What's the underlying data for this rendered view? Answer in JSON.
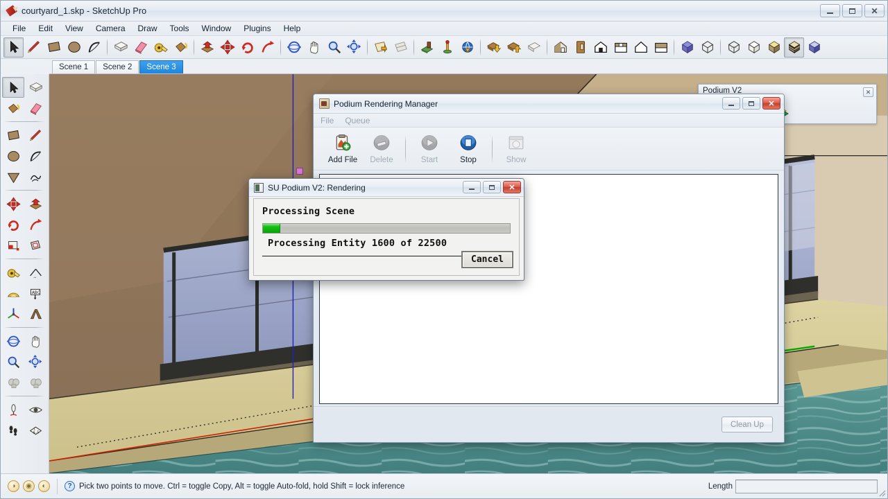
{
  "window": {
    "title": "courtyard_1.skp - SketchUp Pro",
    "app_icon": "sketchup-pencil-icon",
    "controls": {
      "minimize": "–",
      "restore": "❐",
      "close": "✕"
    }
  },
  "menubar": {
    "items": [
      "File",
      "Edit",
      "View",
      "Camera",
      "Draw",
      "Tools",
      "Window",
      "Plugins",
      "Help"
    ]
  },
  "toolbar_top": {
    "groups": [
      {
        "buttons": [
          {
            "name": "select-tool",
            "icon": "arrow-cursor-icon",
            "pressed": true
          },
          {
            "name": "line-tool",
            "icon": "pencil-icon",
            "pressed": false
          },
          {
            "name": "rectangle-tool",
            "icon": "rectangle-icon",
            "pressed": false
          },
          {
            "name": "circle-tool",
            "icon": "circle-icon",
            "pressed": false
          },
          {
            "name": "arc-tool",
            "icon": "arc-icon",
            "pressed": false
          }
        ]
      },
      {
        "buttons": [
          {
            "name": "make-component-tool",
            "icon": "component-icon",
            "pressed": false
          },
          {
            "name": "eraser-tool",
            "icon": "eraser-icon",
            "pressed": false
          },
          {
            "name": "tape-measure-tool",
            "icon": "tape-measure-icon",
            "pressed": false
          },
          {
            "name": "paint-bucket-tool",
            "icon": "paint-bucket-icon",
            "pressed": false
          }
        ]
      },
      {
        "buttons": [
          {
            "name": "push-pull-tool",
            "icon": "push-pull-icon",
            "pressed": false
          },
          {
            "name": "move-tool",
            "icon": "move-arrows-icon",
            "pressed": false
          },
          {
            "name": "rotate-tool",
            "icon": "rotate-icon",
            "pressed": false
          },
          {
            "name": "follow-me-tool",
            "icon": "follow-me-icon",
            "pressed": false
          }
        ]
      },
      {
        "buttons": [
          {
            "name": "orbit-tool",
            "icon": "orbit-icon",
            "pressed": false
          },
          {
            "name": "pan-tool",
            "icon": "hand-icon",
            "pressed": false
          },
          {
            "name": "zoom-tool",
            "icon": "magnifier-icon",
            "pressed": false
          },
          {
            "name": "zoom-extents-tool",
            "icon": "zoom-extents-icon",
            "pressed": false
          }
        ]
      },
      {
        "buttons": [
          {
            "name": "section-plane-tool",
            "icon": "section-plane-icon",
            "pressed": false
          },
          {
            "name": "section-display-tool",
            "icon": "section-display-icon",
            "pressed": false
          }
        ]
      },
      {
        "buttons": [
          {
            "name": "add-location-tool",
            "icon": "geo-location-icon",
            "pressed": false
          },
          {
            "name": "toggle-terrain-tool",
            "icon": "terrain-pin-icon",
            "pressed": false
          },
          {
            "name": "photo-textures-tool",
            "icon": "globe-arrow-icon",
            "pressed": false
          }
        ]
      },
      {
        "buttons": [
          {
            "name": "get-models-tool",
            "icon": "warehouse-download-icon",
            "pressed": false
          },
          {
            "name": "share-model-tool",
            "icon": "warehouse-upload-icon",
            "pressed": false
          },
          {
            "name": "share-component-tool",
            "icon": "share-component-icon",
            "pressed": false
          }
        ]
      },
      {
        "buttons": [
          {
            "name": "style-shaded-texture",
            "icon": "house-textured-icon",
            "pressed": false
          },
          {
            "name": "style-door",
            "icon": "door-icon",
            "pressed": false
          },
          {
            "name": "style-house-solid",
            "icon": "house-solid-icon",
            "pressed": false
          },
          {
            "name": "style-house-flat",
            "icon": "house-flat-icon",
            "pressed": false
          },
          {
            "name": "style-house-outline",
            "icon": "house-outline-icon",
            "pressed": false
          },
          {
            "name": "style-house-shaded",
            "icon": "house-shaded-icon",
            "pressed": false
          }
        ]
      },
      {
        "buttons": [
          {
            "name": "face-style-xray",
            "icon": "cube-xray-icon",
            "pressed": false
          },
          {
            "name": "face-style-wireframe",
            "icon": "cube-wireframe-icon",
            "pressed": false
          }
        ]
      },
      {
        "buttons": [
          {
            "name": "face-style-hidden-line",
            "icon": "cube-hidden-line-icon",
            "pressed": false
          },
          {
            "name": "face-style-monochrome",
            "icon": "cube-monochrome-icon",
            "pressed": false
          },
          {
            "name": "face-style-shaded",
            "icon": "cube-shaded-icon",
            "pressed": false
          },
          {
            "name": "face-style-textured",
            "icon": "cube-textured-icon",
            "pressed": true
          },
          {
            "name": "face-style-blue",
            "icon": "cube-blue-icon",
            "pressed": false
          }
        ]
      }
    ]
  },
  "tabs": {
    "scenes": [
      {
        "label": "Scene 1",
        "active": false
      },
      {
        "label": "Scene 2",
        "active": false
      },
      {
        "label": "Scene 3",
        "active": true
      }
    ]
  },
  "toolbar_left": {
    "rows": [
      {
        "sep_after": false,
        "buttons": [
          {
            "name": "select-tool",
            "icon": "arrow-cursor-icon",
            "pressed": true
          },
          {
            "name": "make-component-tool",
            "icon": "component-icon",
            "pressed": false
          }
        ]
      },
      {
        "sep_after": true,
        "buttons": [
          {
            "name": "paint-bucket-tool",
            "icon": "paint-bucket-icon",
            "pressed": false
          },
          {
            "name": "eraser-tool",
            "icon": "eraser-icon",
            "pressed": false
          }
        ]
      },
      {
        "sep_after": false,
        "buttons": [
          {
            "name": "rectangle-tool",
            "icon": "rectangle-icon",
            "pressed": false
          },
          {
            "name": "line-tool",
            "icon": "pencil-icon",
            "pressed": false
          }
        ]
      },
      {
        "sep_after": false,
        "buttons": [
          {
            "name": "circle-tool",
            "icon": "circle-icon",
            "pressed": false
          },
          {
            "name": "arc-tool",
            "icon": "arc-icon",
            "pressed": false
          }
        ]
      },
      {
        "sep_after": true,
        "buttons": [
          {
            "name": "polygon-tool",
            "icon": "polygon-icon",
            "pressed": false
          },
          {
            "name": "freehand-tool",
            "icon": "freehand-icon",
            "pressed": false
          }
        ]
      },
      {
        "sep_after": false,
        "buttons": [
          {
            "name": "move-tool",
            "icon": "move-arrows-icon",
            "pressed": false
          },
          {
            "name": "push-pull-tool",
            "icon": "push-pull-icon",
            "pressed": false
          }
        ]
      },
      {
        "sep_after": false,
        "buttons": [
          {
            "name": "rotate-tool",
            "icon": "rotate-icon",
            "pressed": false
          },
          {
            "name": "follow-me-tool",
            "icon": "follow-me-icon",
            "pressed": false
          }
        ]
      },
      {
        "sep_after": true,
        "buttons": [
          {
            "name": "scale-tool",
            "icon": "scale-icon",
            "pressed": false
          },
          {
            "name": "offset-tool",
            "icon": "offset-icon",
            "pressed": false
          }
        ]
      },
      {
        "sep_after": false,
        "buttons": [
          {
            "name": "tape-measure-tool",
            "icon": "tape-measure-icon",
            "pressed": false
          },
          {
            "name": "dimension-tool",
            "icon": "dimension-icon",
            "pressed": false
          }
        ]
      },
      {
        "sep_after": false,
        "buttons": [
          {
            "name": "protractor-tool",
            "icon": "protractor-icon",
            "pressed": false
          },
          {
            "name": "text-tool",
            "icon": "text-abc-icon",
            "pressed": false
          }
        ]
      },
      {
        "sep_after": true,
        "buttons": [
          {
            "name": "axes-tool",
            "icon": "axes-icon",
            "pressed": false
          },
          {
            "name": "three-d-text-tool",
            "icon": "three-d-text-icon",
            "pressed": false
          }
        ]
      },
      {
        "sep_after": false,
        "buttons": [
          {
            "name": "orbit-tool",
            "icon": "orbit-icon",
            "pressed": false
          },
          {
            "name": "pan-tool",
            "icon": "hand-icon",
            "pressed": false
          }
        ]
      },
      {
        "sep_after": false,
        "buttons": [
          {
            "name": "zoom-tool",
            "icon": "magnifier-icon",
            "pressed": false
          },
          {
            "name": "zoom-extents-tool",
            "icon": "zoom-extents-icon",
            "pressed": false
          }
        ]
      },
      {
        "sep_after": true,
        "buttons": [
          {
            "name": "zoom-window-tool",
            "icon": "camera-disabled-icon",
            "pressed": false
          },
          {
            "name": "previous-view-tool",
            "icon": "camera-disabled-icon",
            "pressed": false
          }
        ]
      },
      {
        "sep_after": false,
        "buttons": [
          {
            "name": "position-camera-tool",
            "icon": "position-camera-icon",
            "pressed": false
          },
          {
            "name": "look-around-tool",
            "icon": "eye-icon",
            "pressed": false
          }
        ]
      },
      {
        "sep_after": false,
        "buttons": [
          {
            "name": "walk-tool",
            "icon": "footprints-icon",
            "pressed": false
          },
          {
            "name": "section-marker-tool",
            "icon": "section-marker-icon",
            "pressed": false
          }
        ]
      }
    ]
  },
  "viewport": {
    "name": "sketchup-3d-viewport",
    "description": "Courtyard model: stucco wall, glass curtain wall, deck and pool",
    "colors": {
      "sky": "#eceae4",
      "wall": "#927a5e",
      "wall_shadow": "#6f5b45",
      "wall_light": "#c9b28c",
      "glass": "#9aa3c4",
      "glass_light": "#c2c8df",
      "mullion": "#2b2b28",
      "deck": "#d9cf9a",
      "deck_dark": "#b9ab76",
      "water": "#4f8f8c",
      "water_light": "#8fc0bc",
      "axis_red": "#cc2200",
      "axis_blue": "#2222bb",
      "axis_green": "#00aa00"
    }
  },
  "podium_toolbar": {
    "title": "Podium V2",
    "close_label": "✕",
    "buttons": [
      {
        "name": "podium-render-button",
        "icon": "render-lamp-icon"
      },
      {
        "name": "podium-options-button",
        "icon": "gear-icon"
      },
      {
        "name": "podium-materials-button",
        "icon": "materials-box-icon"
      },
      {
        "name": "podium-lights-button",
        "icon": "light-tool-icon"
      }
    ]
  },
  "rendering_manager": {
    "title": "Podium Rendering Manager",
    "icon": "podium-window-icon",
    "controls": {
      "minimize": "–",
      "restore": "❐",
      "close": "✕"
    },
    "menus": [
      {
        "label": "File",
        "enabled": false
      },
      {
        "label": "Queue",
        "enabled": false
      }
    ],
    "toolbar": [
      {
        "label": "Add File",
        "icon": "add-file-icon",
        "enabled": true
      },
      {
        "label": "Delete",
        "icon": "delete-icon",
        "enabled": false
      },
      {
        "label": "Start",
        "icon": "start-play-icon",
        "enabled": false
      },
      {
        "label": "Stop",
        "icon": "stop-icon",
        "enabled": true
      },
      {
        "label": "Show",
        "icon": "show-window-icon",
        "enabled": false
      }
    ],
    "queue_items": [],
    "cleanup_button": {
      "label": "Clean Up",
      "enabled": false
    }
  },
  "progress_dialog": {
    "title": "SU Podium V2: Rendering",
    "icon": "podium-render-icon",
    "controls": {
      "minimize": "–",
      "restore": "❐",
      "close": "✕"
    },
    "heading": "Processing Scene",
    "status": "Processing Entity 1600 of 22500",
    "progress": {
      "current": 1600,
      "total": 22500,
      "percent": 7
    },
    "cancel_button": "Cancel",
    "bar_color": "#19c019"
  },
  "statusbar": {
    "geo_icons": [
      {
        "name": "geo-credit-icon",
        "glyph": "◑"
      },
      {
        "name": "geo-solar-icon",
        "glyph": "◉"
      },
      {
        "name": "geo-terrain-icon",
        "glyph": "◐"
      }
    ],
    "help_icon": "?",
    "message": "Pick two points to move.  Ctrl = toggle Copy, Alt = toggle Auto-fold, hold Shift = lock inference",
    "vcb_label": "Length",
    "vcb_value": "",
    "vcb_placeholder": ""
  }
}
